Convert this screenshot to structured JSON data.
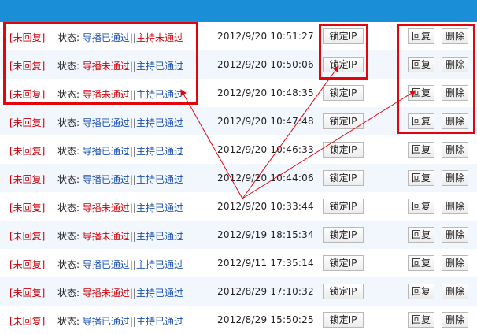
{
  "rows": [
    {
      "reply_state": "[未回复]",
      "status_label": "状态:",
      "director_status": "导播已通过",
      "host_status": "主持未通过",
      "time": "2012/9/20  10:51:27",
      "lock_ip_label": "锁定IP",
      "reply_label": "回复",
      "delete_label": "删除"
    },
    {
      "reply_state": "[未回复]",
      "status_label": "状态:",
      "director_status": "导播未通过",
      "host_status": "主持已通过",
      "time": "2012/9/20  10:50:06",
      "lock_ip_label": "锁定IP",
      "reply_label": "回复",
      "delete_label": "删除"
    },
    {
      "reply_state": "[未回复]",
      "status_label": "状态:",
      "director_status": "导播未通过",
      "host_status": "主持已通过",
      "time": "2012/9/20  10:48:35",
      "lock_ip_label": "锁定IP",
      "reply_label": "回复",
      "delete_label": "删除"
    },
    {
      "reply_state": "[未回复]",
      "status_label": "状态:",
      "director_status": "导播已通过",
      "host_status": "主持已通过",
      "time": "2012/9/20  10:47:48",
      "lock_ip_label": "锁定IP",
      "reply_label": "回复",
      "delete_label": "删除"
    },
    {
      "reply_state": "[未回复]",
      "status_label": "状态:",
      "director_status": "导播已通过",
      "host_status": "主持已通过",
      "time": "2012/9/20  10:46:33",
      "lock_ip_label": "锁定IP",
      "reply_label": "回复",
      "delete_label": "删除"
    },
    {
      "reply_state": "[未回复]",
      "status_label": "状态:",
      "director_status": "导播已通过",
      "host_status": "主持已通过",
      "time": "2012/9/20  10:44:06",
      "lock_ip_label": "锁定IP",
      "reply_label": "回复",
      "delete_label": "删除"
    },
    {
      "reply_state": "[未回复]",
      "status_label": "状态:",
      "director_status": "导播未通过",
      "host_status": "主持已通过",
      "time": "2012/9/20  10:33:44",
      "lock_ip_label": "锁定IP",
      "reply_label": "回复",
      "delete_label": "删除"
    },
    {
      "reply_state": "[未回复]",
      "status_label": "状态:",
      "director_status": "导播未通过",
      "host_status": "主持已通过",
      "time": "2012/9/19  18:15:34",
      "lock_ip_label": "锁定IP",
      "reply_label": "回复",
      "delete_label": "删除"
    },
    {
      "reply_state": "[未回复]",
      "status_label": "状态:",
      "director_status": "导播已通过",
      "host_status": "主持已通过",
      "time": "2012/9/11  17:35:14",
      "lock_ip_label": "锁定IP",
      "reply_label": "回复",
      "delete_label": "删除"
    },
    {
      "reply_state": "[未回复]",
      "status_label": "状态:",
      "director_status": "导播未通过",
      "host_status": "主持已通过",
      "time": "2012/8/29  17:10:32",
      "lock_ip_label": "锁定IP",
      "reply_label": "回复",
      "delete_label": "删除"
    },
    {
      "reply_state": "[未回复]",
      "status_label": "状态:",
      "director_status": "导播已通过",
      "host_status": "主持已通过",
      "time": "2012/8/29  15:50:25",
      "lock_ip_label": "锁定IP",
      "reply_label": "回复",
      "delete_label": "删除"
    }
  ],
  "separator": "||",
  "colors": {
    "header_bar": "#1a8fd8",
    "passed": "#1b4fb0",
    "not_passed": "#d0050c",
    "reply_state": "#c8000a",
    "annotation": "#e0060c",
    "row_alt": "#f2f6fd"
  }
}
